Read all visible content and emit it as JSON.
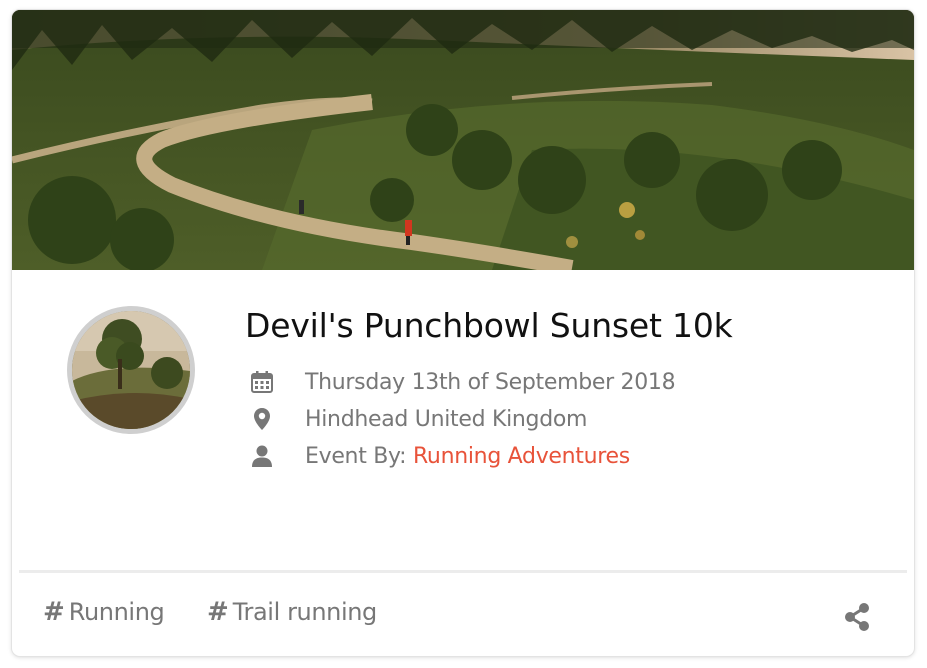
{
  "event": {
    "title": "Devil's Punchbowl Sunset 10k",
    "date": "Thursday 13th of September 2018",
    "location": "Hindhead United Kingdom",
    "organizer_prefix": "Event By: ",
    "organizer_name": "Running Adventures"
  },
  "tags": [
    {
      "symbol": "#",
      "label": "Running"
    },
    {
      "symbol": "#",
      "label": "Trail running"
    }
  ],
  "icons": {
    "date": "calendar-icon",
    "location": "map-marker-icon",
    "organizer": "user-icon",
    "tag": "hashtag-icon",
    "share": "share-icon"
  },
  "colors": {
    "accent": "#e8533a",
    "muted_text": "#777777",
    "title_text": "#111111",
    "icon": "#777777"
  }
}
